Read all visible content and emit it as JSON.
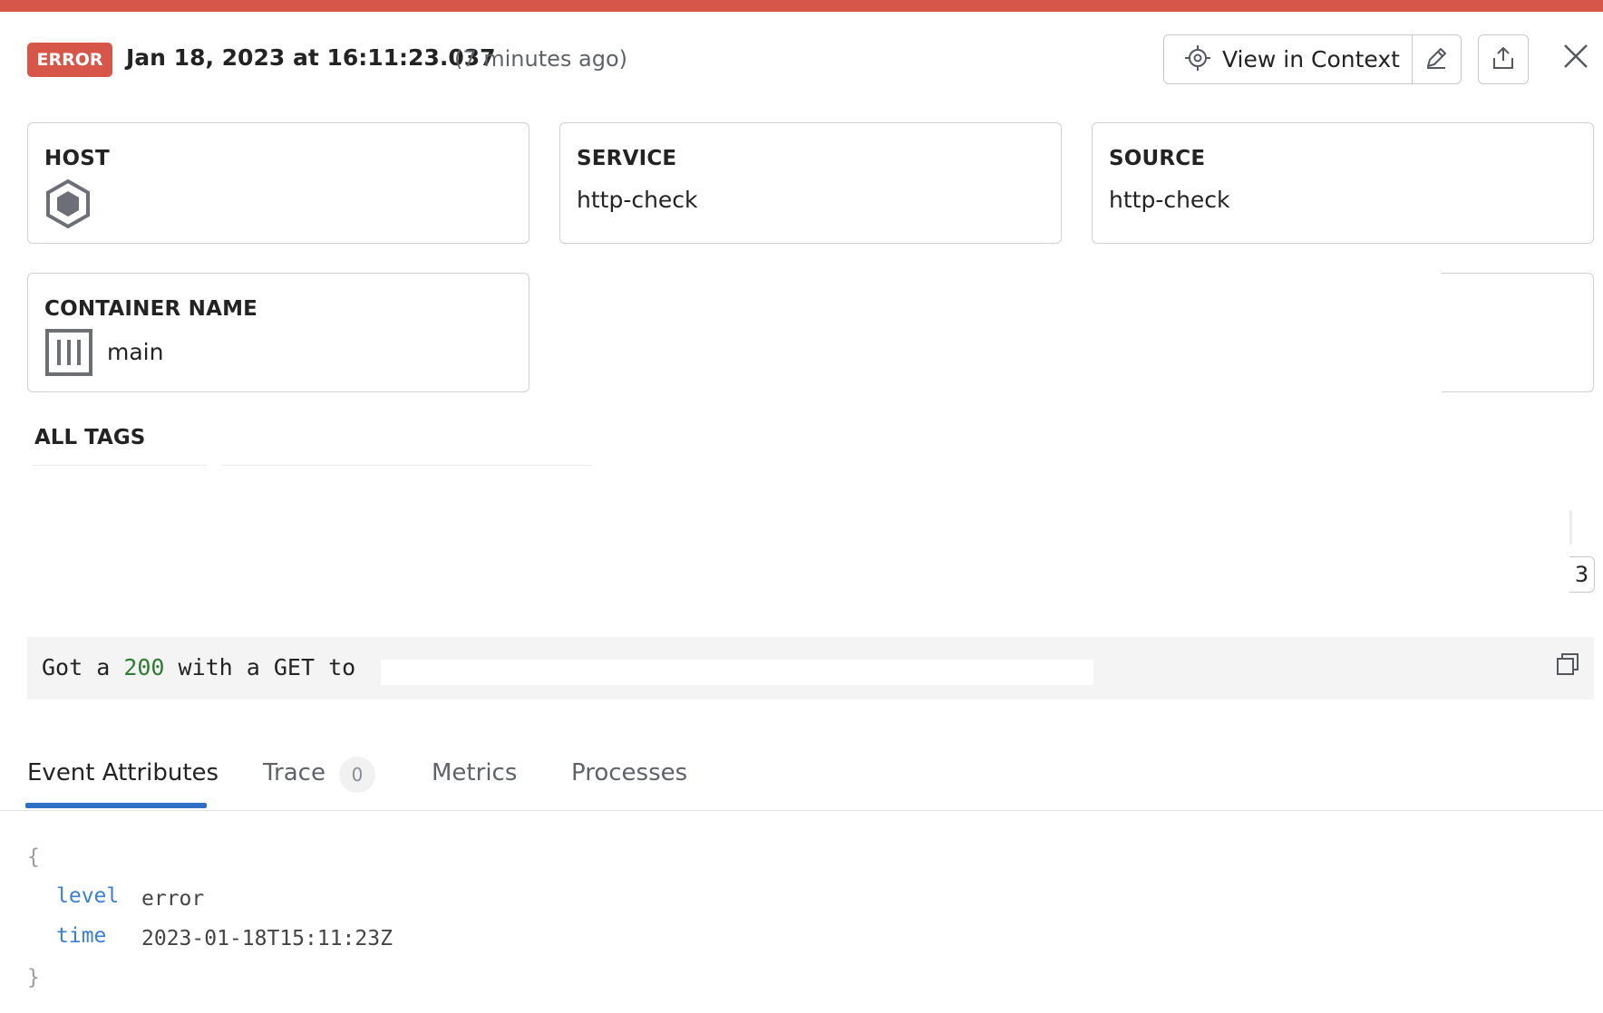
{
  "header": {
    "status": "ERROR",
    "timestamp": "Jan 18, 2023 at 16:11:23.037",
    "relative_time": "(7 minutes ago)",
    "view_in_context_label": "View in Context",
    "colors": {
      "error": "#d6574a",
      "accent": "#2f6fc4"
    }
  },
  "cards": {
    "host": {
      "label": "HOST",
      "icon": "hexagon-host-icon"
    },
    "service": {
      "label": "SERVICE",
      "value": "http-check"
    },
    "source": {
      "label": "SOURCE",
      "value": "http-check"
    },
    "container": {
      "label": "CONTAINER NAME",
      "value": "main",
      "icon": "container-icon"
    }
  },
  "tags": {
    "title": "ALL TAGS",
    "page_indicator": "3"
  },
  "message": {
    "prefix": "Got a ",
    "status_code": "200",
    "suffix": " with a GET to "
  },
  "tabs": [
    {
      "label": "Event Attributes"
    },
    {
      "label": "Trace",
      "count": "0"
    },
    {
      "label": "Metrics"
    },
    {
      "label": "Processes"
    }
  ],
  "attributes": {
    "open_brace": "{",
    "close_brace": "}",
    "rows": [
      {
        "key": "level",
        "value": "error"
      },
      {
        "key": "time",
        "value": "2023-01-18T15:11:23Z"
      }
    ]
  }
}
